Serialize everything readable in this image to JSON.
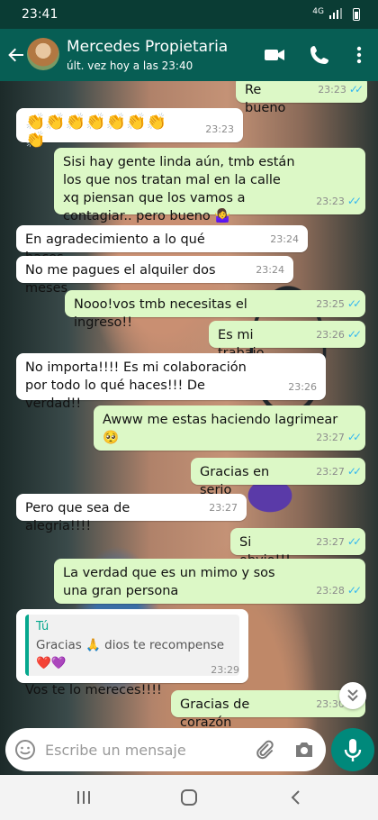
{
  "status": {
    "time": "23:41",
    "network": "4G"
  },
  "header": {
    "contact_name": "Mercedes Propietaria",
    "last_seen": "últ. vez hoy a las 23:40"
  },
  "messages": [
    {
      "dir": "out",
      "text": "Re bueno",
      "time": "23:23"
    },
    {
      "dir": "in",
      "text": "👏👏👏👏👏👏👏👏",
      "time": "23:23"
    },
    {
      "dir": "out",
      "text": "Sisi hay gente linda aún, tmb están los que nos tratan mal en la calle xq piensan que los vamos a contagiar.. pero bueno 🤷‍♀️",
      "time": "23:23"
    },
    {
      "dir": "in",
      "text": "En agradecimiento a lo qué haces.....",
      "time": "23:24"
    },
    {
      "dir": "in",
      "text": "No me pagues el alquiler dos meses",
      "time": "23:24"
    },
    {
      "dir": "out",
      "text": "Nooo!vos tmb necesitas el ingreso!!",
      "time": "23:25"
    },
    {
      "dir": "out",
      "text": "Es mi trabajo",
      "time": "23:26"
    },
    {
      "dir": "in",
      "text": "No importa!!!! Es mi colaboración por todo lo qué haces!!! De verdad!!",
      "time": "23:26"
    },
    {
      "dir": "out",
      "text": "Awww me estas haciendo lagrimear 🥺",
      "time": "23:27"
    },
    {
      "dir": "out",
      "text": "Gracias en serio",
      "time": "23:27"
    },
    {
      "dir": "in",
      "text": "Pero que sea de alegria!!!!",
      "time": "23:27"
    },
    {
      "dir": "out",
      "text": "Si obvio!!!",
      "time": "23:27"
    },
    {
      "dir": "out",
      "text": "La verdad que es un mimo y sos una gran persona",
      "time": "23:28"
    },
    {
      "dir": "in",
      "text": "Vos te lo mereces!!!!",
      "time": "23:29",
      "quote_author": "Tú",
      "quote_text": "Gracias 🙏 dios te recompense ❤️💜"
    },
    {
      "dir": "out",
      "text": "Gracias de corazón",
      "time": "23:30"
    }
  ],
  "composer": {
    "placeholder": "Escribe un mensaje"
  },
  "icons": {
    "back": "arrow-left-icon",
    "video": "video-call-icon",
    "phone": "phone-icon",
    "menu": "more-vert-icon",
    "emoji": "smiley-icon",
    "attach": "paperclip-icon",
    "camera": "camera-icon",
    "mic": "mic-icon",
    "scroll": "chevron-double-down-icon",
    "nav_recents": "recents-icon",
    "nav_home": "home-icon",
    "nav_back": "back-icon"
  },
  "colors": {
    "header": "#075e54",
    "outgoing": "#dcf8c6",
    "incoming": "#ffffff",
    "ticks": "#34b7f1",
    "mic": "#00897b"
  }
}
